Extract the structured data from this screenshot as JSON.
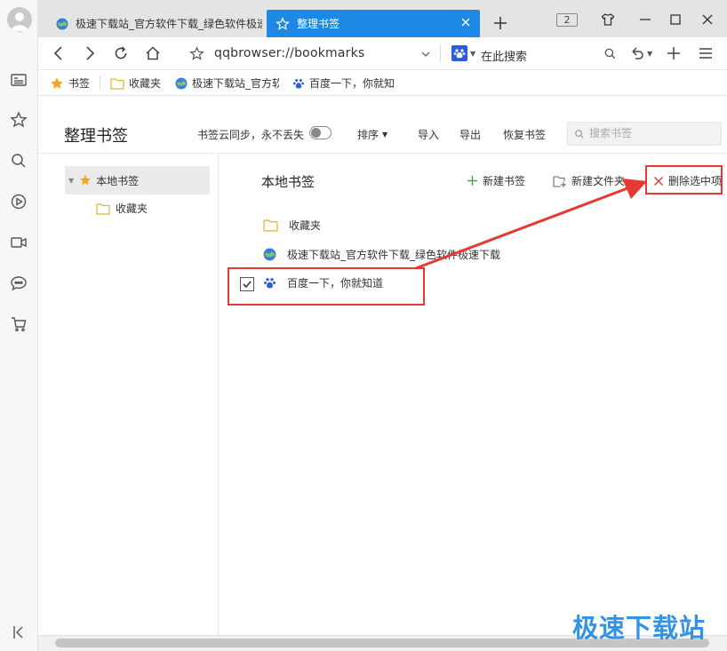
{
  "tabs": [
    {
      "title": "极速下载站_官方软件下载_绿色软件极速下载",
      "active": false
    },
    {
      "title": "整理书签",
      "active": true
    }
  ],
  "tabstrip": {
    "tab_count": "2"
  },
  "address": {
    "url": "qqbrowser://bookmarks",
    "search_engine_label": "在此搜索"
  },
  "bookmarks_bar": {
    "items": [
      {
        "label": "书签",
        "icon": "star-icon"
      },
      {
        "label": "收藏夹",
        "icon": "folder-icon"
      },
      {
        "label": "极速下载站_官方软件",
        "icon": "globe-icon"
      },
      {
        "label": "百度一下，你就知",
        "icon": "baidu-paw-icon"
      }
    ]
  },
  "manager": {
    "title": "整理书签",
    "cloud_sync_label": "书签云同步，永不丢失",
    "sync_enabled": false,
    "sort_label": "排序",
    "import_label": "导入",
    "export_label": "导出",
    "restore_label": "恢复书签",
    "search_placeholder": "搜索书签"
  },
  "tree": {
    "root_label": "本地书签",
    "children": [
      {
        "label": "收藏夹"
      }
    ]
  },
  "content": {
    "title": "本地书签",
    "new_bookmark_label": "新建书签",
    "new_folder_label": "新建文件夹",
    "delete_label": "删除选中项",
    "items": [
      {
        "label": "收藏夹",
        "icon": "folder-icon",
        "checked": false
      },
      {
        "label": "极速下载站_官方软件下载_绿色软件极速下载",
        "icon": "globe-icon",
        "checked": false
      },
      {
        "label": "百度一下，你就知道",
        "icon": "baidu-paw-icon",
        "checked": true
      }
    ]
  },
  "watermark": "极速下载站",
  "colors": {
    "accent": "#1e88e5",
    "highlight": "#e53935",
    "star": "#f5a623",
    "folder": "#f3c545"
  }
}
